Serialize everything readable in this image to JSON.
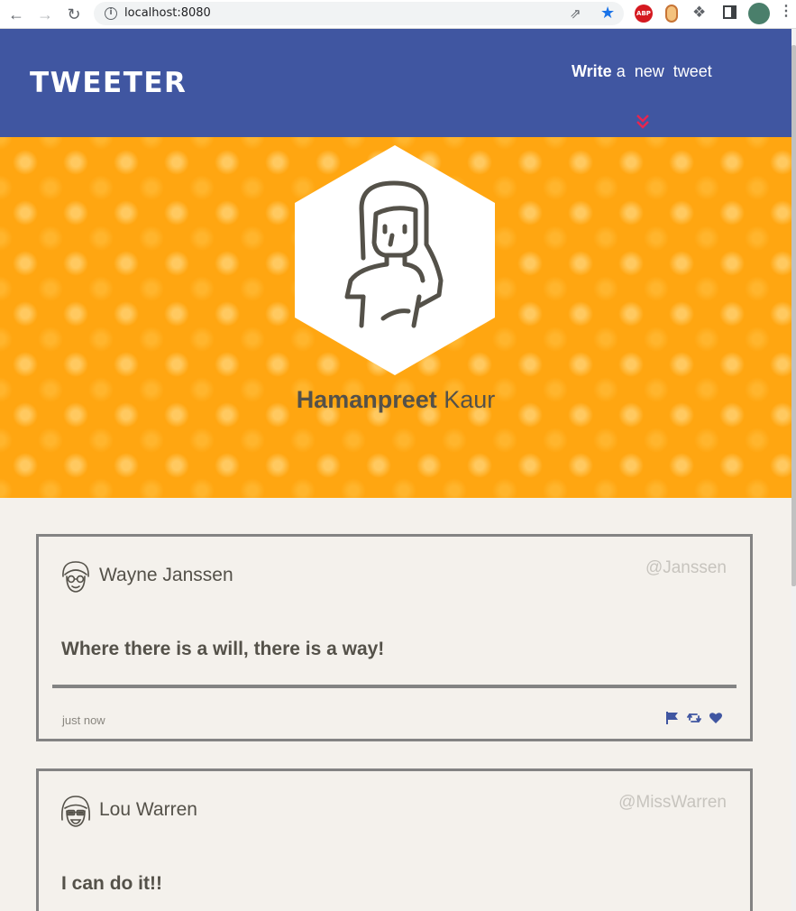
{
  "browser": {
    "url": "localhost:8080",
    "abp_label": "ABP",
    "icons": [
      "back-arrow-icon",
      "forward-arrow-icon",
      "reload-icon",
      "info-icon",
      "share-icon",
      "star-icon",
      "adblock-icon",
      "honey-icon",
      "puzzle-icon",
      "side-panel-icon",
      "profile-avatar-icon",
      "more-menu-icon"
    ]
  },
  "app": {
    "logo": "TWEETER",
    "compose": {
      "bold": "Write",
      "rest": "a  new  tweet"
    },
    "brand_color": "#4056a1",
    "accent_color": "#e8254f"
  },
  "profile": {
    "first_name": "Hamanpreet",
    "last_name": "Kaur",
    "hero_color": "#ffa611"
  },
  "tweets": [
    {
      "author": "Wayne Janssen",
      "handle": "@Janssen",
      "content": "Where there is a will, there is a way!",
      "timestamp": "just now",
      "actions": [
        "flag-icon",
        "retweet-icon",
        "heart-icon"
      ]
    },
    {
      "author": "Lou Warren",
      "handle": "@MissWarren",
      "content": "I can do it!!"
    }
  ]
}
